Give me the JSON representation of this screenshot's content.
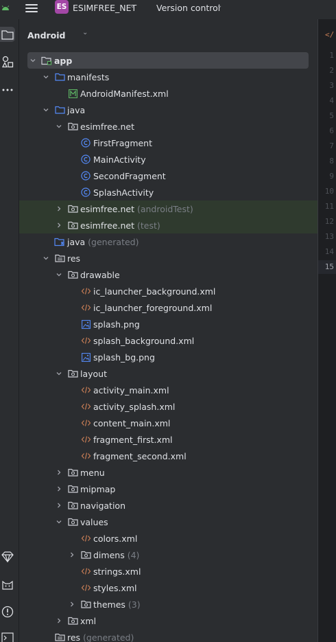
{
  "titlebar": {
    "project_badge": "ES",
    "project_name": "ESIMFREE_NET",
    "vcs_label": "Version control"
  },
  "panel": {
    "title": "Android"
  },
  "colors": {
    "folder": "#548af7",
    "package": "#ced0d6",
    "class": "#548af7",
    "xml": "#c77d55",
    "image": "#548af7",
    "manifest": "#5fb865",
    "dim_text": "#7a7e85",
    "selection": "#43454a",
    "test_highlight": "#2f3a2e"
  },
  "tree": [
    {
      "label": "app",
      "indent": 0,
      "icon": "module-folder-icon",
      "expanded": true,
      "selected": true,
      "bold": true
    },
    {
      "label": "manifests",
      "indent": 1,
      "icon": "folder-icon",
      "expanded": true
    },
    {
      "label": "AndroidManifest.xml",
      "indent": 2,
      "icon": "manifest-icon",
      "leaf": true
    },
    {
      "label": "java",
      "indent": 1,
      "icon": "folder-icon",
      "expanded": true
    },
    {
      "label": "esimfree.net",
      "indent": 2,
      "icon": "package-icon",
      "expanded": true
    },
    {
      "label": "FirstFragment",
      "indent": 3,
      "icon": "class-icon",
      "leaf": true
    },
    {
      "label": "MainActivity",
      "indent": 3,
      "icon": "class-icon",
      "leaf": true
    },
    {
      "label": "SecondFragment",
      "indent": 3,
      "icon": "class-icon",
      "leaf": true
    },
    {
      "label": "SplashActivity",
      "indent": 3,
      "icon": "class-icon",
      "leaf": true
    },
    {
      "label": "esimfree.net",
      "suffix": "(androidTest)",
      "indent": 2,
      "icon": "package-icon",
      "expanded": false,
      "highlight": true
    },
    {
      "label": "esimfree.net",
      "suffix": "(test)",
      "indent": 2,
      "icon": "package-icon",
      "expanded": false,
      "highlight": true
    },
    {
      "label": "java",
      "suffix": "(generated)",
      "indent": 1,
      "icon": "generated-folder-icon",
      "leaf": true
    },
    {
      "label": "res",
      "indent": 1,
      "icon": "res-folder-icon",
      "expanded": true
    },
    {
      "label": "drawable",
      "indent": 2,
      "icon": "package-icon",
      "expanded": true
    },
    {
      "label": "ic_launcher_background.xml",
      "indent": 3,
      "icon": "xml-icon",
      "leaf": true
    },
    {
      "label": "ic_launcher_foreground.xml",
      "indent": 3,
      "icon": "xml-icon",
      "leaf": true
    },
    {
      "label": "splash.png",
      "indent": 3,
      "icon": "image-icon",
      "leaf": true
    },
    {
      "label": "splash_background.xml",
      "indent": 3,
      "icon": "xml-icon",
      "leaf": true
    },
    {
      "label": "splash_bg.png",
      "indent": 3,
      "icon": "image-icon",
      "leaf": true
    },
    {
      "label": "layout",
      "indent": 2,
      "icon": "package-icon",
      "expanded": true
    },
    {
      "label": "activity_main.xml",
      "indent": 3,
      "icon": "xml-icon",
      "leaf": true
    },
    {
      "label": "activity_splash.xml",
      "indent": 3,
      "icon": "xml-icon",
      "leaf": true
    },
    {
      "label": "content_main.xml",
      "indent": 3,
      "icon": "xml-icon",
      "leaf": true
    },
    {
      "label": "fragment_first.xml",
      "indent": 3,
      "icon": "xml-icon",
      "leaf": true
    },
    {
      "label": "fragment_second.xml",
      "indent": 3,
      "icon": "xml-icon",
      "leaf": true
    },
    {
      "label": "menu",
      "indent": 2,
      "icon": "package-icon",
      "expanded": false
    },
    {
      "label": "mipmap",
      "indent": 2,
      "icon": "package-icon",
      "expanded": false
    },
    {
      "label": "navigation",
      "indent": 2,
      "icon": "package-icon",
      "expanded": false
    },
    {
      "label": "values",
      "indent": 2,
      "icon": "package-icon",
      "expanded": true
    },
    {
      "label": "colors.xml",
      "indent": 3,
      "icon": "xml-icon",
      "leaf": true
    },
    {
      "label": "dimens",
      "suffix": "(4)",
      "indent": 3,
      "icon": "package-icon",
      "expanded": false
    },
    {
      "label": "strings.xml",
      "indent": 3,
      "icon": "xml-icon",
      "leaf": true
    },
    {
      "label": "styles.xml",
      "indent": 3,
      "icon": "xml-icon",
      "leaf": true
    },
    {
      "label": "themes",
      "suffix": "(3)",
      "indent": 3,
      "icon": "package-icon",
      "expanded": false
    },
    {
      "label": "xml",
      "indent": 2,
      "icon": "package-icon",
      "expanded": false
    },
    {
      "label": "res",
      "suffix": "(generated)",
      "indent": 1,
      "icon": "res-folder-icon",
      "leaf": true
    }
  ],
  "editor": {
    "line_numbers": [
      "1",
      "2",
      "3",
      "4",
      "5",
      "6",
      "7",
      "8",
      "9",
      "10",
      "11",
      "12",
      "13",
      "14",
      "15"
    ],
    "current_line": "15"
  }
}
